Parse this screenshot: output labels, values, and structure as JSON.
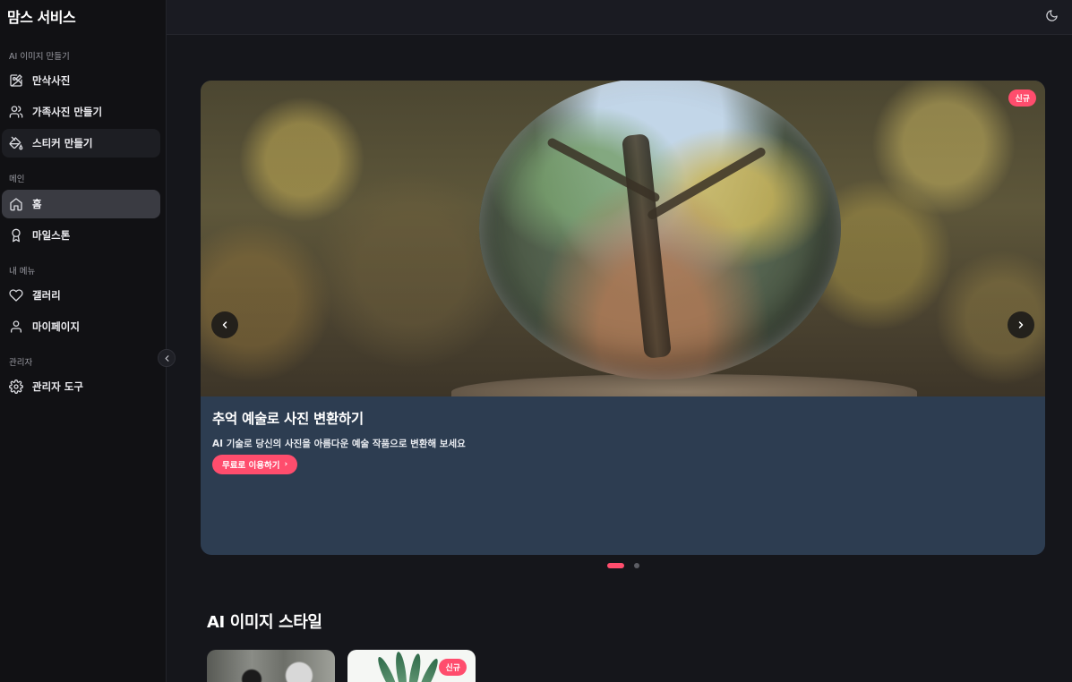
{
  "brand": "맘스 서비스",
  "sidebar": {
    "sections": [
      {
        "label": "AI 이미지 만들기"
      },
      {
        "label": "메인"
      },
      {
        "label": "내 메뉴"
      },
      {
        "label": "관리자"
      }
    ],
    "items": [
      {
        "label": "만삭사진",
        "icon": "image-edit-icon"
      },
      {
        "label": "가족사진 만들기",
        "icon": "users-icon"
      },
      {
        "label": "스티커 만들기",
        "icon": "paint-bucket-icon"
      },
      {
        "label": "홈",
        "icon": "home-icon"
      },
      {
        "label": "마일스톤",
        "icon": "award-icon"
      },
      {
        "label": "갤러리",
        "icon": "heart-icon"
      },
      {
        "label": "마이페이지",
        "icon": "user-icon"
      },
      {
        "label": "관리자 도구",
        "icon": "settings-icon"
      }
    ]
  },
  "carousel": {
    "badge": "신규",
    "title": "추억 예술로 사진 변환하기",
    "description": "AI 기술로 당신의 사진을 아름다운 예술 작품으로 변환해 보세요",
    "cta_label": "무료로 이용하기",
    "cta_chevron": "›",
    "slide_count": 2,
    "active_index": 0
  },
  "styles_section": {
    "title": "AI 이미지 스타일",
    "cards": [
      {
        "name": "panda"
      },
      {
        "name": "leaf",
        "badge": "신규"
      }
    ]
  },
  "colors": {
    "accent": "#ff4d6d",
    "sidebar_bg": "#111114",
    "main_bg": "#15161b",
    "caption_bg": "#2d3d51"
  }
}
